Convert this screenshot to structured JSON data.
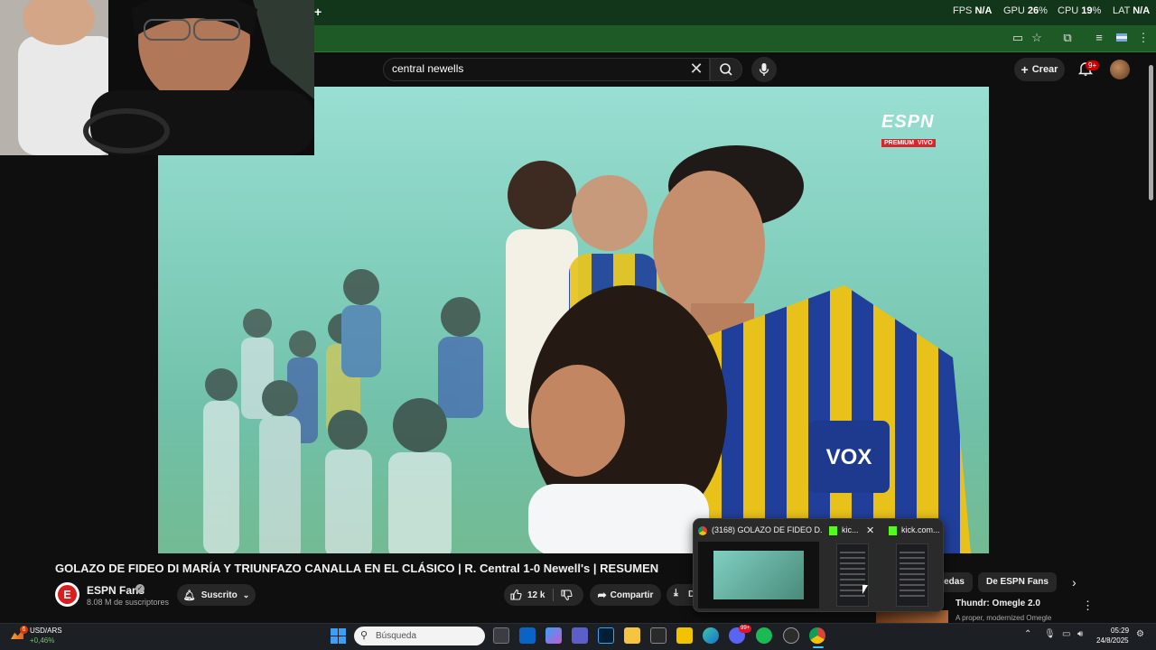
{
  "browser": {
    "new_tab_symbol": "+",
    "perf": {
      "fps_label": "FPS",
      "fps_value": "N/A",
      "gpu_label": "GPU",
      "gpu_value": "26",
      "cpu_label": "CPU",
      "cpu_value": "19",
      "lat_label": "LAT",
      "lat_value": "N/A",
      "percent": "%"
    }
  },
  "youtube": {
    "search_value": "central newells",
    "create_label": "Crear",
    "notifications_badge": "9+"
  },
  "video": {
    "overlay_brand": "ESPN",
    "overlay_tag": "PREMIUM  VIVO",
    "jersey_text": "VOX"
  },
  "watch": {
    "title": "GOLAZO DE FIDEO DI MARÍA Y TRIUNFAZO CANALLA EN EL CLÁSICO | R. Central 1-0 Newell's | RESUMEN",
    "channel_initial": "E",
    "channel_name": "ESPN Fans",
    "subscribers": "8.08 M de suscriptores",
    "subscribed_label": "Suscrito",
    "likes": "12 k",
    "share_label": "Compartir",
    "download_label": "D"
  },
  "recommendations": {
    "chips": [
      "uedas",
      "De ESPN Fans"
    ],
    "first_title": "Thundr: Omegle 2.0",
    "first_subtitle": "A proper, modernized Omegle"
  },
  "taskbar_preview": {
    "items": [
      {
        "title": "(3168) GOLAZO DE FIDEO D..."
      },
      {
        "title": "kic..."
      },
      {
        "title": "kick.com..."
      }
    ]
  },
  "taskbar": {
    "stock_name": "USD/ARS",
    "stock_change": "+0,46%",
    "stock_badge": "6",
    "search_placeholder": "Búsqueda",
    "discord_badge": "99+",
    "time": "05:29",
    "date": "24/8/2025"
  },
  "colors": {
    "browser_frame": "#1e5a25",
    "youtube_bg": "#0f0f0f",
    "accent_red": "#cc0000"
  }
}
